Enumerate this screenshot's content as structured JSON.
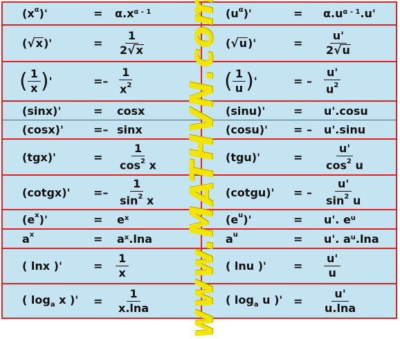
{
  "watermark": "www.MATHVN.com",
  "r1": {
    "l_lhs": "(x",
    "l_sup": "α",
    "l_lhs2": ")'",
    "l_rhs": "α.x",
    "l_rsup": "α - 1",
    "r_lhs": "(u",
    "r_sup": "α",
    "r_lhs2": ")'",
    "r_rhs": "α.u",
    "r_rsup": "α - 1",
    "r_rhs2": ".u'"
  },
  "r2": {
    "l_var": "x",
    "l_num": "1",
    "l_den_c": "2",
    "l_den_v": "x",
    "r_var": "u",
    "r_num": "u'",
    "r_den_c": "2",
    "r_den_v": "u"
  },
  "r3": {
    "l_pn": "1",
    "l_pd": "x",
    "l_num": "1",
    "l_den": "x",
    "l_dsup": "2",
    "r_pn": "1",
    "r_pd": "u",
    "r_num": "u'",
    "r_den": "u",
    "r_dsup": "2"
  },
  "r4": {
    "l_lhs": "(sinx)'",
    "l_rhs": "cosx",
    "r_lhs": "(sinu)'",
    "r_rhs": "u'.cosu"
  },
  "r5": {
    "l_lhs": "(cosx)'",
    "l_rhs": "sinx",
    "r_lhs": "(cosu)'",
    "r_rhs": "u'.sinu"
  },
  "r6": {
    "l_lhs": "(tgx)'",
    "l_num": "1",
    "l_den": "cos",
    "l_dsup": "2",
    "l_den2": " x",
    "r_lhs": "(tgu)'",
    "r_num": "u'",
    "r_den": "cos",
    "r_dsup": "2",
    "r_den2": " u"
  },
  "r7": {
    "l_lhs": "(cotgx)'",
    "l_num": "1",
    "l_den": "sin",
    "l_dsup": "2",
    "l_den2": " x",
    "r_lhs": "(cotgu)'",
    "r_num": "u'",
    "r_den": "sin",
    "r_dsup": "2",
    "r_den2": " u"
  },
  "r8": {
    "l_lhs": "(e",
    "l_sup": "x",
    "l_lhs2": ")'",
    "l_rhs": "e",
    "l_rsup": "x",
    "r_lhs": "(e",
    "r_sup": "u",
    "r_lhs2": ")'",
    "r_rhs": "u'. e",
    "r_rsup": "u"
  },
  "r9": {
    "l_lhs": "a",
    "l_sup": "x",
    "l_rhs": "a",
    "l_rsup": "x",
    "l_rhs2": ".lna",
    "r_lhs": "a",
    "r_sup": "u",
    "r_rhs": "u'. a",
    "r_rsup": "u",
    "r_rhs2": ".lna"
  },
  "r10": {
    "l_lhs": "( lnx )'",
    "l_num": "1",
    "l_den": "x",
    "r_lhs": "( lnu )'",
    "r_num": "u'",
    "r_den": "u"
  },
  "r11": {
    "l_lhs": "( log",
    "l_sub": "a",
    "l_lhs2": " x )'",
    "l_num": "1",
    "l_den": "x.lna",
    "r_lhs": "( log",
    "r_sub": "a",
    "r_lhs2": " u )'",
    "r_num": "u'",
    "r_den": "u.lna"
  },
  "eq": "=",
  "minus": "–"
}
